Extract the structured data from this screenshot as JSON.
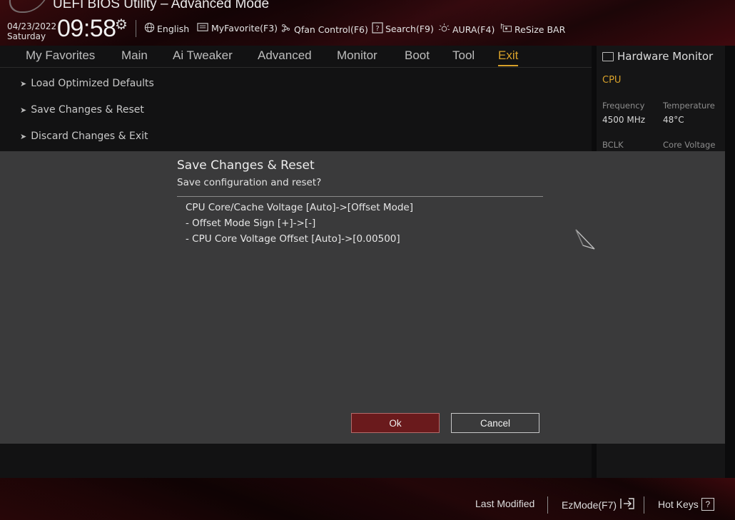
{
  "header": {
    "app_title": "UEFI BIOS Utility – Advanced Mode",
    "date": "04/23/2022",
    "day": "Saturday",
    "time": "09:58",
    "toolbar": [
      {
        "id": "language",
        "label": "English",
        "icon": "globe-icon"
      },
      {
        "id": "myfavorite",
        "label": "MyFavorite(F3)",
        "icon": "favorite-icon"
      },
      {
        "id": "qfan",
        "label": "Qfan Control(F6)",
        "icon": "fan-icon"
      },
      {
        "id": "search",
        "label": "Search(F9)",
        "icon": "search-icon"
      },
      {
        "id": "aura",
        "label": "AURA(F4)",
        "icon": "aura-icon"
      },
      {
        "id": "resizebar",
        "label": "ReSize BAR",
        "icon": "resizebar-icon"
      }
    ]
  },
  "nav": {
    "tabs": [
      {
        "label": "My Favorites"
      },
      {
        "label": "Main"
      },
      {
        "label": "Ai Tweaker"
      },
      {
        "label": "Advanced"
      },
      {
        "label": "Monitor"
      },
      {
        "label": "Boot"
      },
      {
        "label": "Tool"
      },
      {
        "label": "Exit",
        "active": true
      }
    ]
  },
  "exit_menu": {
    "items": [
      {
        "label": "Load Optimized Defaults"
      },
      {
        "label": "Save Changes & Reset"
      },
      {
        "label": "Discard Changes & Exit"
      }
    ]
  },
  "hardware_monitor": {
    "title": "Hardware Monitor",
    "section": "CPU",
    "fields": [
      {
        "label": "Frequency",
        "value": "4500 MHz"
      },
      {
        "label": "Temperature",
        "value": "48°C"
      },
      {
        "label": "BCLK",
        "value": ""
      },
      {
        "label": "Core Voltage",
        "value": ""
      }
    ]
  },
  "dialog": {
    "title": "Save Changes & Reset",
    "subtitle": "Save configuration and reset?",
    "changes": [
      "CPU Core/Cache Voltage [Auto]->[Offset Mode]",
      "- Offset Mode Sign [+]->[-]",
      "- CPU Core Voltage Offset [Auto]->[0.00500]"
    ],
    "ok_label": "Ok",
    "cancel_label": "Cancel"
  },
  "footer": {
    "last_modified": "Last Modified",
    "ezmode": "EzMode(F7)",
    "hotkeys": "Hot Keys",
    "hotkeys_icon_text": "?"
  },
  "colors": {
    "accent": "#d8a12a",
    "ok_button": "#6a1a1c",
    "dialog_bg": "#3a3a3b"
  }
}
